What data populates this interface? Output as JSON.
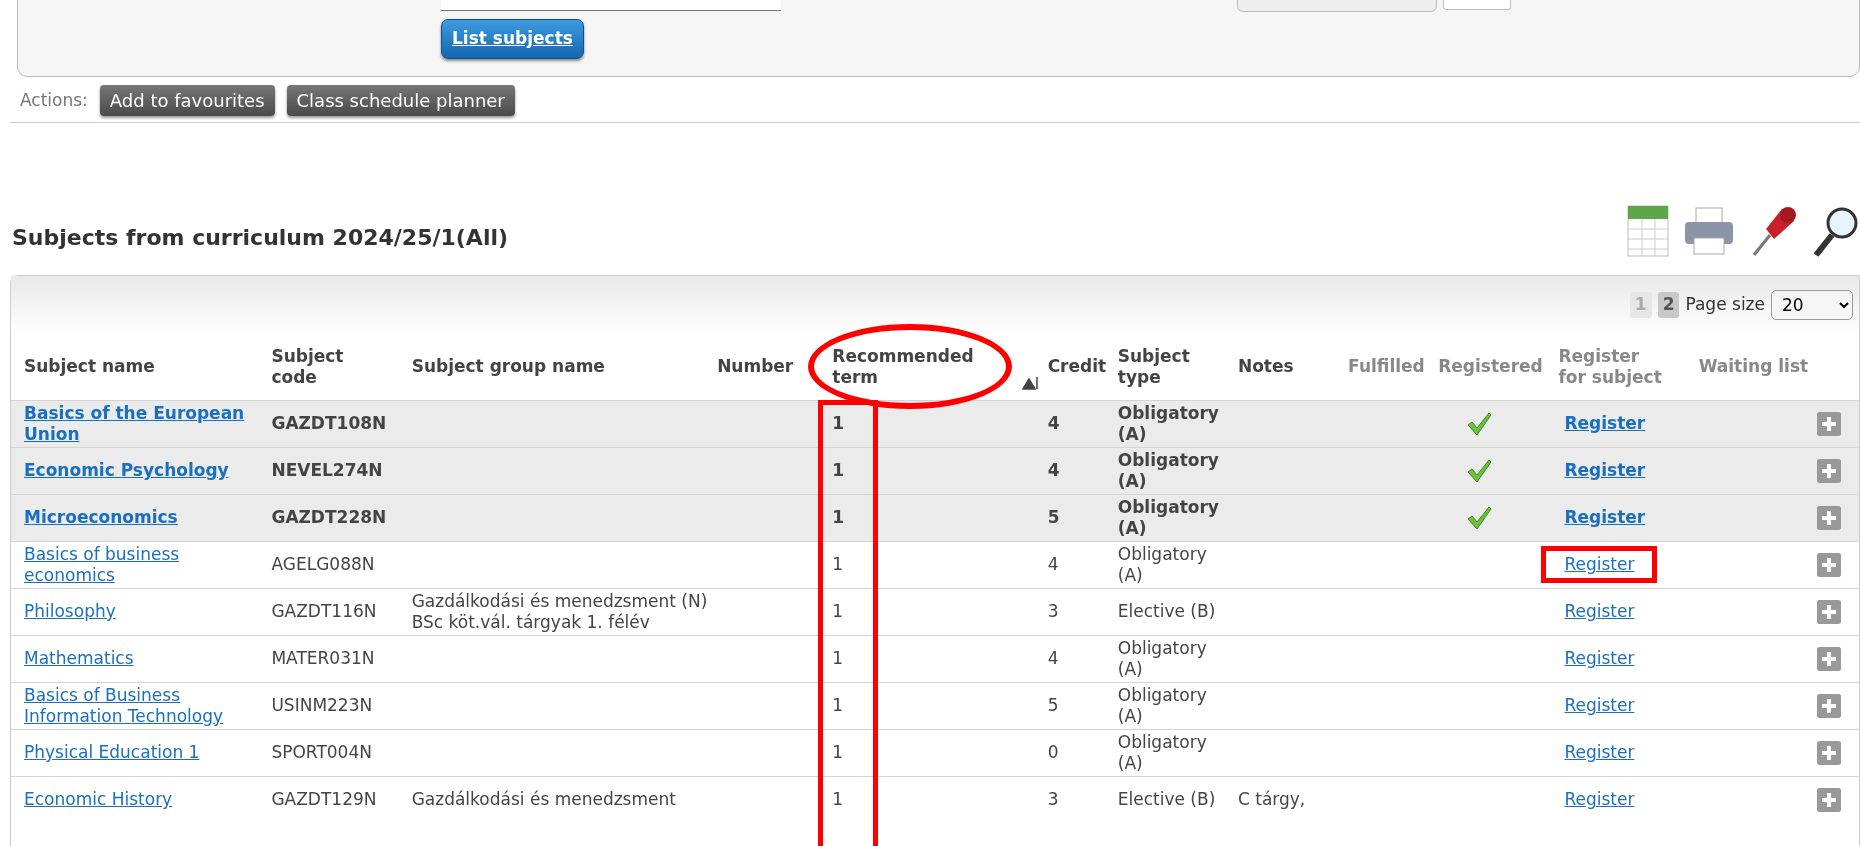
{
  "filter_panel": {
    "button": "List subjects"
  },
  "actions": {
    "label": "Actions:",
    "buttons": [
      "Add to favourites",
      "Class schedule planner"
    ]
  },
  "section_title": "Subjects from curriculum 2024/25/1(All)",
  "pagination": {
    "pages": [
      {
        "label": "1",
        "selected": false
      },
      {
        "label": "2",
        "selected": true
      }
    ],
    "page_size_label": "Page size",
    "page_size": "20"
  },
  "table": {
    "columns": [
      {
        "label": "Subject name",
        "muted": false
      },
      {
        "label": "Subject code",
        "muted": false
      },
      {
        "label": "Subject group name",
        "muted": false
      },
      {
        "label": "Number",
        "muted": false
      },
      {
        "label": "Recommended term",
        "muted": false,
        "sorted": true,
        "circled": true,
        "boxed": true
      },
      {
        "label": "Credit",
        "muted": false
      },
      {
        "label": "Subject type",
        "muted": false
      },
      {
        "label": "Notes",
        "muted": false
      },
      {
        "label": "Fulfilled",
        "muted": true
      },
      {
        "label": "Registered",
        "muted": true
      },
      {
        "label": "Register for subject",
        "muted": true
      },
      {
        "label": "Waiting list",
        "muted": true
      }
    ],
    "rows": [
      {
        "name": "Basics of the European Union",
        "code": "GAZDT108N",
        "term": "1",
        "credit": "4",
        "type": "Obligatory (A)",
        "registered": true,
        "register": "Register",
        "highlighted": false
      },
      {
        "name": "Economic Psychology",
        "code": "NEVEL274N",
        "term": "1",
        "credit": "4",
        "type": "Obligatory (A)",
        "registered": true,
        "register": "Register",
        "highlighted": false
      },
      {
        "name": "Microeconomics",
        "code": "GAZDT228N",
        "term": "1",
        "credit": "5",
        "type": "Obligatory (A)",
        "registered": true,
        "register": "Register",
        "highlighted": false
      },
      {
        "name": "Basics of business economics",
        "code": "AGELG088N",
        "term": "1",
        "credit": "4",
        "type": "Obligatory (A)",
        "registered": false,
        "register": "Register",
        "highlighted": true
      },
      {
        "name": "Philosophy",
        "code": "GAZDT116N",
        "group": "Gazdálkodási és menedzsment (N) BSc köt.vál. tárgyak 1. félév",
        "term": "1",
        "credit": "3",
        "type": "Elective (B)",
        "registered": false,
        "register": "Register",
        "highlighted": false
      },
      {
        "name": "Mathematics",
        "code": "MATER031N",
        "term": "1",
        "credit": "4",
        "type": "Obligatory (A)",
        "registered": false,
        "register": "Register",
        "highlighted": false
      },
      {
        "name": "Basics of Business Information Technology",
        "code": "USINM223N",
        "term": "1",
        "credit": "5",
        "type": "Obligatory (A)",
        "registered": false,
        "register": "Register",
        "highlighted": false
      },
      {
        "name": "Physical Education 1",
        "code": "SPORT004N",
        "term": "1",
        "credit": "0",
        "type": "Obligatory (A)",
        "registered": false,
        "register": "Register",
        "highlighted": false
      },
      {
        "name": "Economic History",
        "code": "GAZDT129N",
        "group": "Gazdálkodási és menedzsment",
        "term": "1",
        "credit": "3",
        "type": "Elective (B)",
        "notes": "C tárgy,",
        "registered": false,
        "register": "Register",
        "highlighted": false
      }
    ]
  }
}
